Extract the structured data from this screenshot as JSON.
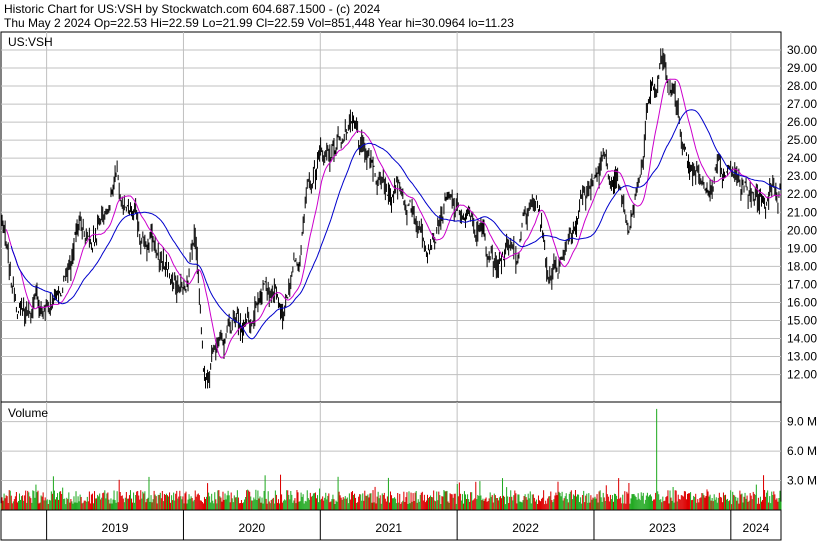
{
  "header": {
    "line1": "Historic Chart for US:VSH by Stockwatch.com 604.687.1500 - (c) 2024",
    "line2": "Thu May  2 2024  Op=22.53  Hi=22.59  Lo=21.99  Cl=22.59  Vol=851,448  Year hi=30.0964  lo=11.23"
  },
  "colors": {
    "price": "#000000",
    "ma_short": "#cc00cc",
    "ma_long": "#0000cc",
    "vol_up": "#22aa22",
    "vol_down": "#dd0000",
    "grid": "#c0c0c0"
  },
  "chart_data": [
    {
      "type": "line",
      "title": "US:VSH",
      "series": [],
      "x_range": [
        "2018-09",
        "2024-05"
      ],
      "ylim": [
        11.23,
        30.0964
      ],
      "y_ticks": [
        "30.00",
        "29.00",
        "28.00",
        "27.00",
        "26.00",
        "25.00",
        "24.00",
        "23.00",
        "22.00",
        "21.00",
        "20.00",
        "19.00",
        "18.00",
        "17.00",
        "16.00",
        "15.00",
        "14.00",
        "13.00",
        "12.00"
      ],
      "x_ticks": [
        "2019",
        "2020",
        "2021",
        "2022",
        "2023",
        "2024"
      ],
      "grid": true,
      "close_keypoints": [
        {
          "date": "2018-09",
          "close": 20.5
        },
        {
          "date": "2018-10",
          "close": 16.5
        },
        {
          "date": "2018-11",
          "close": 15.5
        },
        {
          "date": "2018-12",
          "close": 15.8
        },
        {
          "date": "2019-01",
          "close": 15.7
        },
        {
          "date": "2019-02",
          "close": 16.3
        },
        {
          "date": "2019-03",
          "close": 18.5
        },
        {
          "date": "2019-04",
          "close": 20.5
        },
        {
          "date": "2019-05",
          "close": 19.5
        },
        {
          "date": "2019-06",
          "close": 21.0
        },
        {
          "date": "2019-07",
          "close": 22.8
        },
        {
          "date": "2019-08",
          "close": 20.5
        },
        {
          "date": "2019-09",
          "close": 20.0
        },
        {
          "date": "2019-10",
          "close": 19.5
        },
        {
          "date": "2019-11",
          "close": 18.5
        },
        {
          "date": "2019-12",
          "close": 17.0
        },
        {
          "date": "2020-01",
          "close": 16.5
        },
        {
          "date": "2020-02",
          "close": 19.8
        },
        {
          "date": "2020-03",
          "close": 11.8
        },
        {
          "date": "2020-04",
          "close": 15.0
        },
        {
          "date": "2020-05",
          "close": 14.8
        },
        {
          "date": "2020-06",
          "close": 15.3
        },
        {
          "date": "2020-07",
          "close": 14.8
        },
        {
          "date": "2020-08",
          "close": 15.5
        },
        {
          "date": "2020-09",
          "close": 16.5
        },
        {
          "date": "2020-10",
          "close": 16.0
        },
        {
          "date": "2020-11",
          "close": 19.0
        },
        {
          "date": "2020-12",
          "close": 22.0
        },
        {
          "date": "2021-01",
          "close": 24.0
        },
        {
          "date": "2021-02",
          "close": 24.5
        },
        {
          "date": "2021-03",
          "close": 25.5
        },
        {
          "date": "2021-04",
          "close": 25.0
        },
        {
          "date": "2021-05",
          "close": 23.5
        },
        {
          "date": "2021-06",
          "close": 23.0
        },
        {
          "date": "2021-07",
          "close": 22.5
        },
        {
          "date": "2021-08",
          "close": 22.0
        },
        {
          "date": "2021-09",
          "close": 21.5
        },
        {
          "date": "2021-10",
          "close": 20.0
        },
        {
          "date": "2021-11",
          "close": 20.5
        },
        {
          "date": "2021-12",
          "close": 21.5
        },
        {
          "date": "2022-01",
          "close": 20.8
        },
        {
          "date": "2022-02",
          "close": 20.3
        },
        {
          "date": "2022-03",
          "close": 19.8
        },
        {
          "date": "2022-04",
          "close": 18.5
        },
        {
          "date": "2022-05",
          "close": 19.5
        },
        {
          "date": "2022-06",
          "close": 18.5
        },
        {
          "date": "2022-07",
          "close": 20.8
        },
        {
          "date": "2022-08",
          "close": 21.5
        },
        {
          "date": "2022-09",
          "close": 17.8
        },
        {
          "date": "2022-10",
          "close": 18.5
        },
        {
          "date": "2022-11",
          "close": 20.5
        },
        {
          "date": "2022-12",
          "close": 22.0
        },
        {
          "date": "2023-01",
          "close": 23.0
        },
        {
          "date": "2023-02",
          "close": 23.5
        },
        {
          "date": "2023-03",
          "close": 22.5
        },
        {
          "date": "2023-04",
          "close": 20.8
        },
        {
          "date": "2023-05",
          "close": 24.0
        },
        {
          "date": "2023-06",
          "close": 27.5
        },
        {
          "date": "2023-07",
          "close": 29.5
        },
        {
          "date": "2023-08",
          "close": 28.0
        },
        {
          "date": "2023-09",
          "close": 25.0
        },
        {
          "date": "2023-10",
          "close": 23.5
        },
        {
          "date": "2023-11",
          "close": 22.0
        },
        {
          "date": "2023-12",
          "close": 23.5
        },
        {
          "date": "2024-01",
          "close": 22.5
        },
        {
          "date": "2024-02",
          "close": 21.8
        },
        {
          "date": "2024-03",
          "close": 22.0
        },
        {
          "date": "2024-04",
          "close": 22.3
        },
        {
          "date": "2024-05",
          "close": 22.59
        }
      ]
    },
    {
      "type": "bar",
      "title": "Volume",
      "ylim": [
        0,
        11000000
      ],
      "y_ticks": [
        "9.0 M",
        "6.0 M",
        "3.0 M"
      ],
      "notable": [
        {
          "date": "2023-06",
          "volume": 10300000
        }
      ],
      "typical_volume": 1200000
    }
  ]
}
